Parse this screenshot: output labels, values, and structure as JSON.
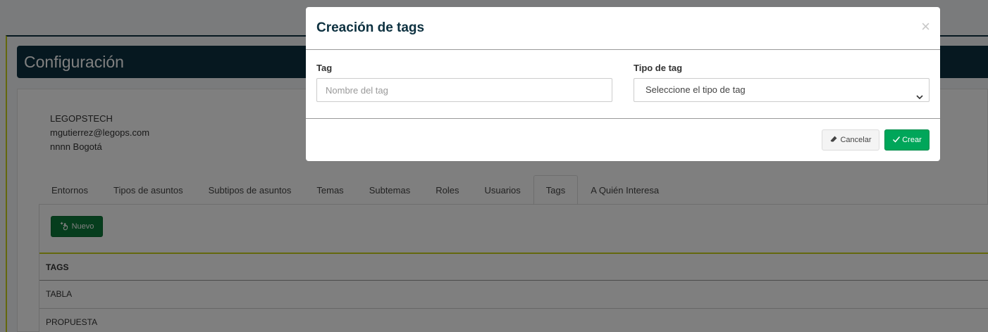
{
  "header": {
    "title": "Configuración"
  },
  "company": {
    "name": "LEGOPSTECH",
    "email": "mgutierrez@legops.com",
    "location": "nnnn Bogotá"
  },
  "tabs": [
    {
      "label": "Entornos"
    },
    {
      "label": "Tipos de asuntos"
    },
    {
      "label": "Subtipos de asuntos"
    },
    {
      "label": "Temas"
    },
    {
      "label": "Subtemas"
    },
    {
      "label": "Roles"
    },
    {
      "label": "Usuarios"
    },
    {
      "label": "Tags"
    },
    {
      "label": "A Quién Interesa"
    }
  ],
  "active_tab": "Tags",
  "toolbar": {
    "new_label": "Nuevo",
    "new_icon": "add-hand-icon"
  },
  "table": {
    "header": "TAGS",
    "rows": [
      "TABLA",
      "PROPUESTA"
    ]
  },
  "modal": {
    "title": "Creación de tags",
    "close_label": "×",
    "tag_label": "Tag",
    "tag_placeholder": "Nombre del tag",
    "type_label": "Tipo de tag",
    "type_selected": "Seleccione el tipo de tag",
    "cancel_label": "Cancelar",
    "cancel_icon": "eraser-icon",
    "create_label": "Crear",
    "create_icon": "check-icon"
  },
  "colors": {
    "brand_dark": "#0d3140",
    "accent_yellow": "#c9d11a",
    "success": "#00a65a",
    "new_button": "#0d7a3a"
  }
}
